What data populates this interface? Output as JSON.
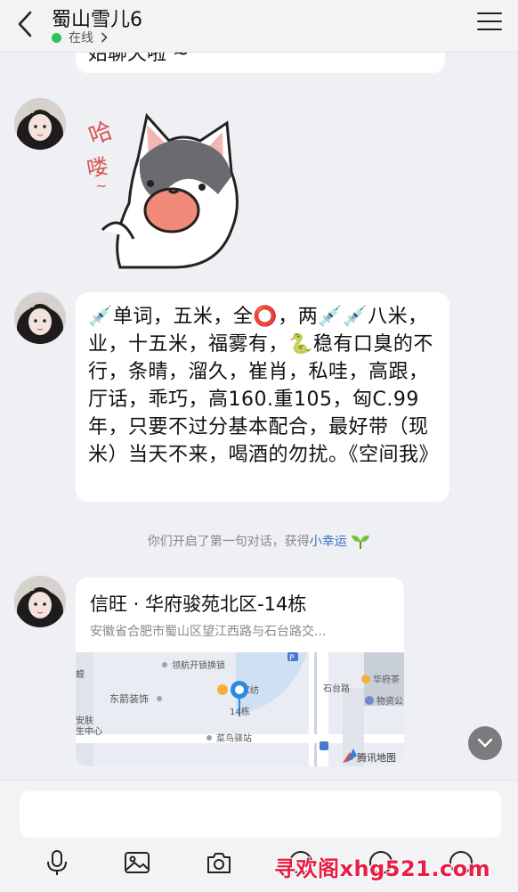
{
  "header": {
    "title": "蜀山雪儿6",
    "status": "在线"
  },
  "messages": {
    "top_partial_text": "始聊天啦 ~",
    "text_message": "💉单词，五米，全⭕，两💉💉八米，业，十五米，福雾有，🐍稳有口臭的不行，条晴，溜久，崔肖，私哇，高跟，厅话，乖巧，高160.重105，匈C.99年，只要不过分基本配合，最好带（现米）当天不来，喝酒的勿扰。《空间我》",
    "system_notice_prefix": "你们开启了第一句对话，获得",
    "system_notice_link": "小幸运",
    "location": {
      "name": "信旺 · 华府骏苑北区-14栋",
      "address": "安徽省合肥市蜀山区望江西路与石台路交..."
    }
  },
  "map": {
    "labels": {
      "lock": "领航开锁换锁",
      "arrow": "东箭装饰",
      "home": "星家纺",
      "pin": "14栋",
      "station": "菜鸟驿站",
      "road": "石台路",
      "huafu": "华府茶",
      "property": "物资公",
      "skin1": "安肤",
      "skin2": "生中心",
      "misc": "蝗",
      "brand": "腾讯地图",
      "parking": "P"
    }
  },
  "input": {
    "placeholder": ""
  },
  "watermark": "寻欢阁xhg521.com",
  "colors": {
    "online": "#2fc15b",
    "link": "#3a6cc6",
    "watermark": "#e81e45"
  }
}
